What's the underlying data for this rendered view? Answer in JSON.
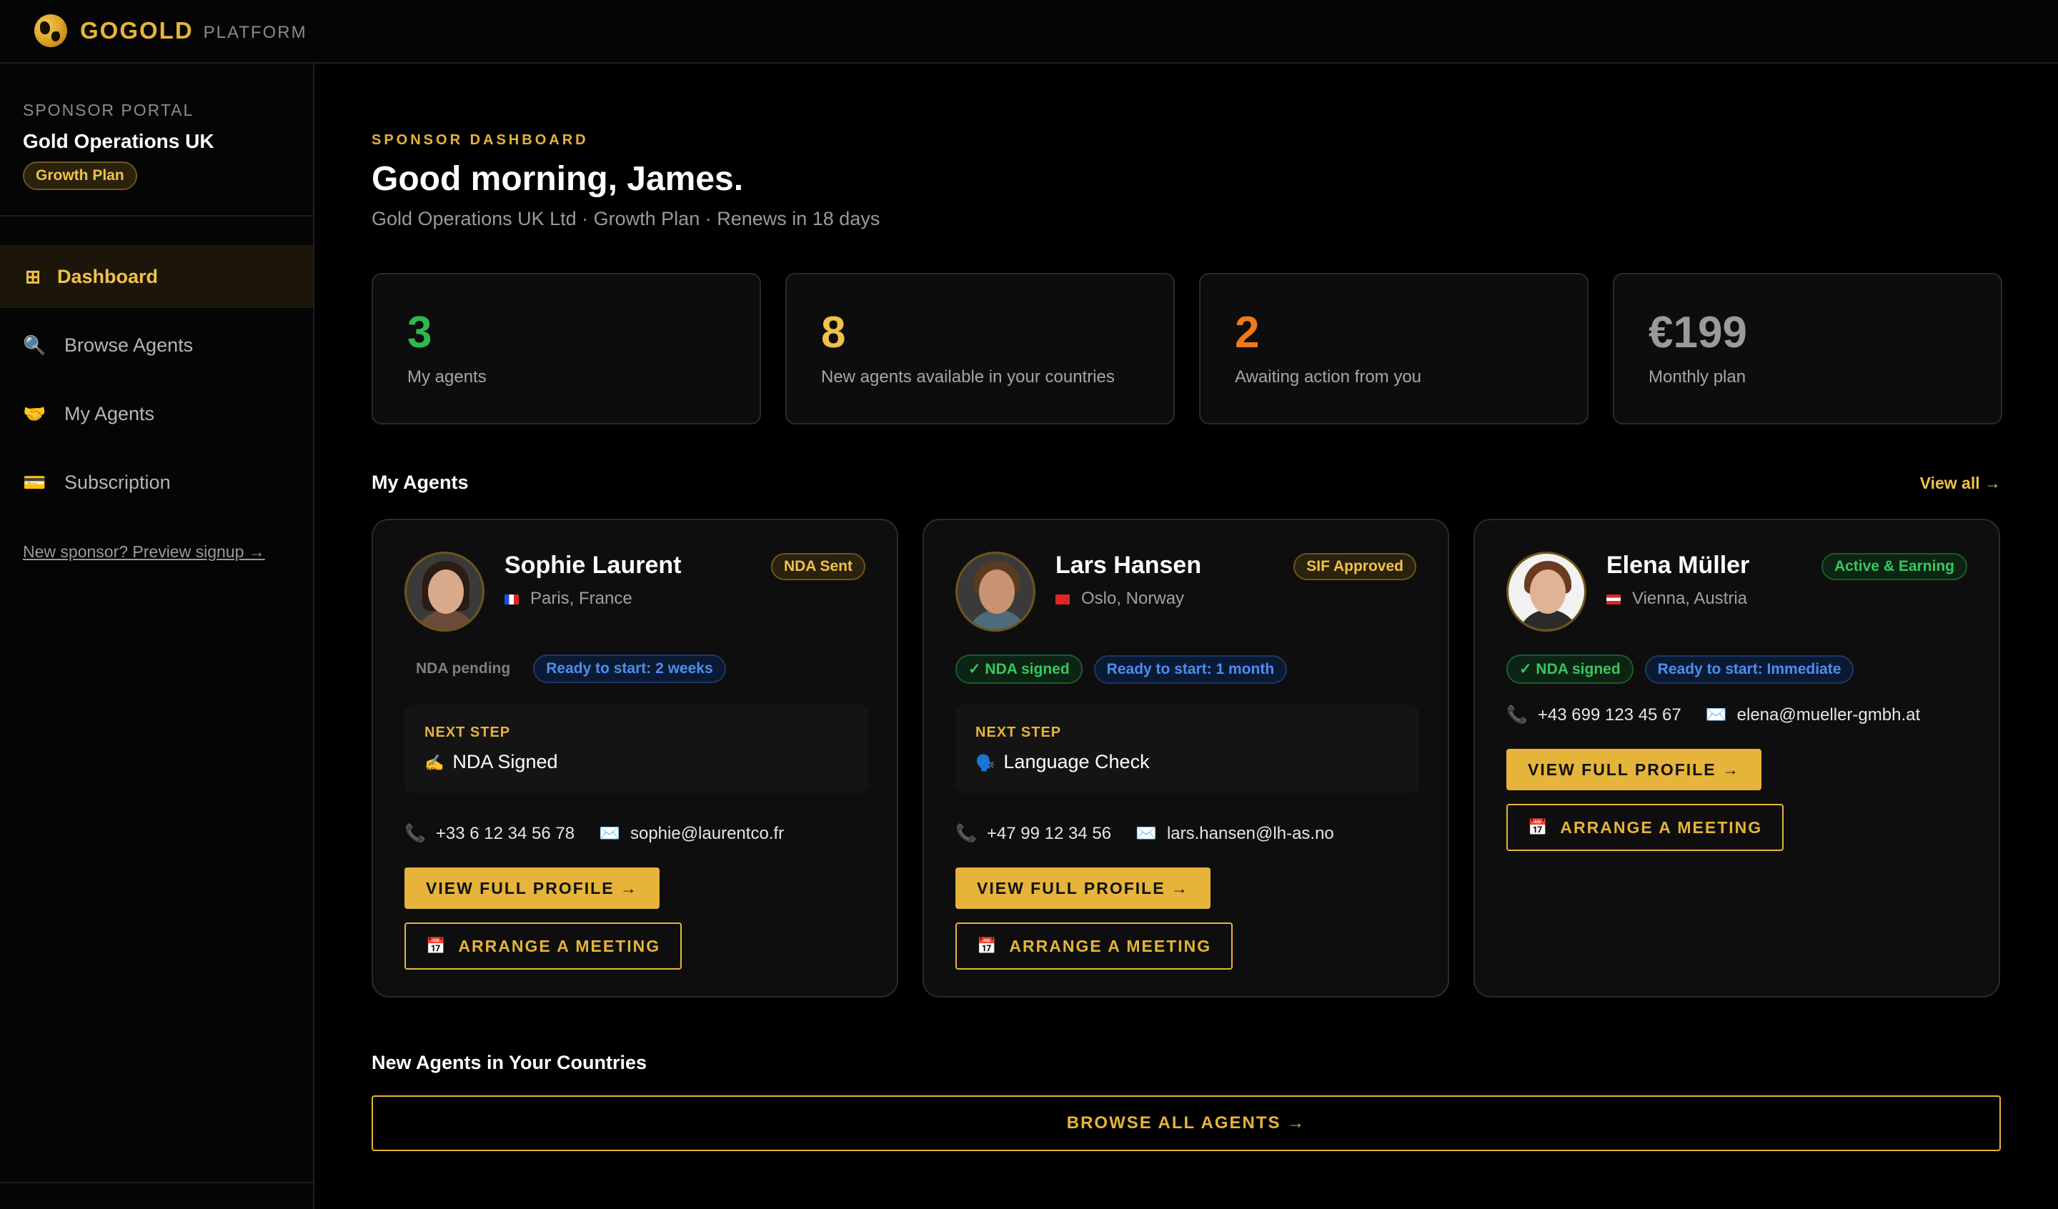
{
  "brand": {
    "name": "GOGOLD",
    "sub": "PLATFORM"
  },
  "sidebar": {
    "portal_label": "SPONSOR PORTAL",
    "org": "Gold Operations UK",
    "plan": "Growth Plan",
    "items": [
      {
        "label": "Dashboard",
        "icon": "grid-icon",
        "glyph": "⊞"
      },
      {
        "label": "Browse Agents",
        "icon": "search-icon",
        "glyph": "🔍"
      },
      {
        "label": "My Agents",
        "icon": "handshake-icon",
        "glyph": "🤝"
      },
      {
        "label": "Subscription",
        "icon": "credit-card-icon",
        "glyph": "💳"
      }
    ],
    "preview_link": "New sponsor? Preview signup →"
  },
  "header": {
    "eyebrow": "SPONSOR DASHBOARD",
    "greeting": "Good morning, James.",
    "subline": "Gold Operations UK Ltd · Growth Plan · Renews in 18 days"
  },
  "stats": [
    {
      "value": "3",
      "label": "My agents",
      "color": "#2fb84f"
    },
    {
      "value": "8",
      "label": "New agents available in your countries",
      "color": "#f0c14b"
    },
    {
      "value": "2",
      "label": "Awaiting action from you",
      "color": "#f07a1a"
    },
    {
      "value": "€199",
      "label": "Monthly plan",
      "color": "#9a9a9a"
    }
  ],
  "my_agents": {
    "title": "My Agents",
    "view_all": "View all →",
    "agents": [
      {
        "name": "Sophie Laurent",
        "location": "Paris, France",
        "status": "NDA Sent",
        "nda": "NDA pending",
        "ready": "Ready to start: 2 weeks",
        "next_label": "NEXT STEP",
        "next_icon": "✍️",
        "next_value": "NDA Signed",
        "phone": "+33 6 12 34 56 78",
        "email": "sophie@laurentco.fr"
      },
      {
        "name": "Lars Hansen",
        "location": "Oslo, Norway",
        "status": "SIF Approved",
        "nda": "✓ NDA signed",
        "ready": "Ready to start: 1 month",
        "next_label": "NEXT STEP",
        "next_icon": "🗣️",
        "next_value": "Language Check",
        "phone": "+47 99 12 34 56",
        "email": "lars.hansen@lh-as.no"
      },
      {
        "name": "Elena Müller",
        "location": "Vienna, Austria",
        "status": "Active & Earning",
        "nda": "✓ NDA signed",
        "ready": "Ready to start: Immediate",
        "phone": "+43 699 123 45 67",
        "email": "elena@mueller-gmbh.at"
      }
    ],
    "view_profile": "VIEW FULL PROFILE →",
    "arrange_meeting": "ARRANGE A MEETING"
  },
  "new_agents": {
    "title": "New Agents in Your Countries",
    "browse_all": "BROWSE ALL AGENTS →"
  }
}
